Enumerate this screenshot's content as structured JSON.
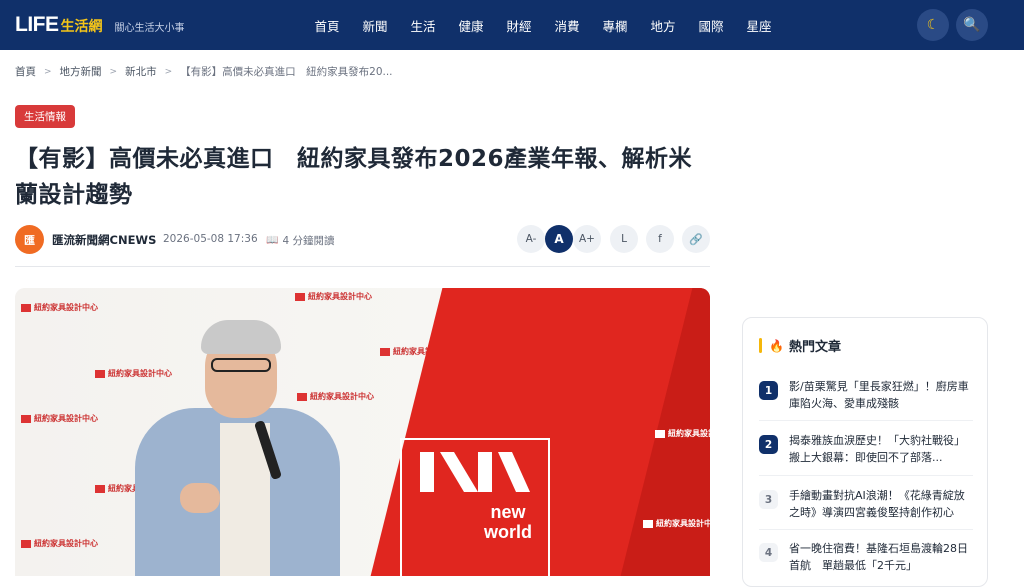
{
  "site": {
    "logo_main": "LIFE",
    "logo_cn": "生活網",
    "tagline": "關心生活大小事"
  },
  "nav": {
    "items": [
      "首頁",
      "新聞",
      "生活",
      "健康",
      "財經",
      "消費",
      "專欄",
      "地方",
      "國際",
      "星座"
    ]
  },
  "icons": {
    "moon": "☾",
    "search": "🔍",
    "book": "📖",
    "fire": "🔥",
    "link": "🔗"
  },
  "breadcrumb": {
    "items": [
      "首頁",
      "地方新聞",
      "新北市"
    ],
    "current": "【有影】高價未必真進口　紐約家具發布20...",
    "sep": ">"
  },
  "article": {
    "category": "生活情報",
    "title": "【有影】高價未必真進口　紐約家具發布2026產業年報、解析米蘭設計趨勢",
    "author_avatar": "匯",
    "author": "匯流新聞網CNEWS",
    "date": "2026-05-08 17:36",
    "read_time": "4 分鐘閱讀"
  },
  "tools": {
    "font_small": "A-",
    "font_mid": "A",
    "font_large": "A+",
    "share_line": "L",
    "share_fb": "f"
  },
  "hero": {
    "wall_logo_text": "紐約家具設計中心",
    "sign_line1": "new",
    "sign_line2": "world"
  },
  "sidebar": {
    "title": "熱門文章",
    "items": [
      {
        "num": "1",
        "text": "影/苗栗驚見「里長家狂燃」！廚房車庫陷火海、愛車成殘骸"
      },
      {
        "num": "2",
        "text": "揭泰雅族血淚歷史！「大豹社戰役」搬上大銀幕：即使回不了部落..."
      },
      {
        "num": "3",
        "text": "手繪動畫對抗AI浪潮！《花綠青綻放之時》導演四宮義俊堅持創作初心"
      },
      {
        "num": "4",
        "text": "省一晚住宿費！基隆石垣島渡輪28日首航　單趟最低「2千元」"
      }
    ]
  },
  "colors": {
    "nav_bg": "#10306a",
    "accent_red": "#d83a3a",
    "logo_yellow": "#f5c518",
    "avatar_orange": "#f06b23"
  }
}
